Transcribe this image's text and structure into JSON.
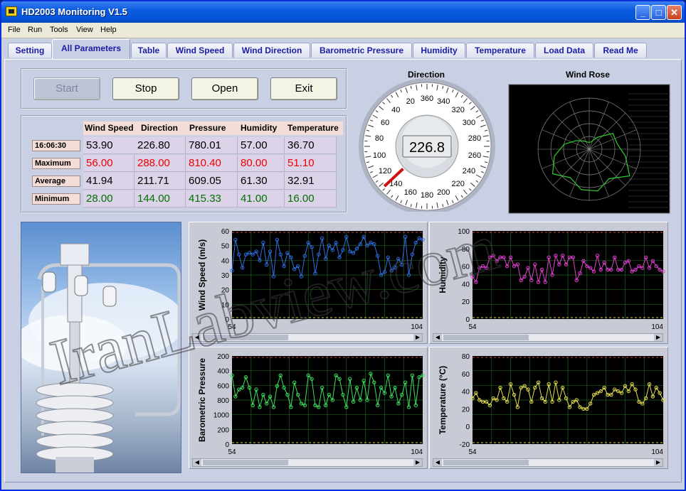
{
  "window": {
    "title": "HD2003 Monitoring V1.5"
  },
  "menu": [
    "File",
    "Run",
    "Tools",
    "View",
    "Help"
  ],
  "tabs": [
    "Setting",
    "All Parameters",
    "Table",
    "Wind Speed",
    "Wind Direction",
    "Barometric Pressure",
    "Humidity",
    "Temperature",
    "Load Data",
    "Read Me"
  ],
  "active_tab": "All Parameters",
  "buttons": {
    "start": "Start",
    "stop": "Stop",
    "open": "Open",
    "exit": "Exit"
  },
  "readings": {
    "headers": [
      "Wind Speed",
      "Direction",
      "Pressure",
      "Humidity",
      "Temperature"
    ],
    "rows": [
      {
        "label": "16:06:30",
        "values": [
          "53.90",
          "226.80",
          "780.01",
          "57.00",
          "36.70"
        ]
      },
      {
        "label": "Maximum",
        "values": [
          "56.00",
          "288.00",
          "810.40",
          "80.00",
          "51.10"
        ]
      },
      {
        "label": "Average",
        "values": [
          "41.94",
          "211.71",
          "609.05",
          "61.30",
          "32.91"
        ]
      },
      {
        "label": "Minimum",
        "values": [
          "28.00",
          "144.00",
          "415.33",
          "41.00",
          "16.00"
        ]
      }
    ]
  },
  "direction": {
    "title": "Direction",
    "value": "226.8",
    "dial_labels": [
      "360",
      "340",
      "320",
      "300",
      "280",
      "260",
      "240",
      "220",
      "200",
      "180",
      "160",
      "140",
      "120",
      "100",
      "80",
      "60",
      "40",
      "20"
    ]
  },
  "wind_rose": {
    "title": "Wind Rose"
  },
  "watermark": "IranLabview.com",
  "colors": {
    "windspeed": "#2f6fe0",
    "humidity": "#e040d0",
    "pressure": "#40e060",
    "temperature": "#e6e050",
    "rose": "#30d030"
  },
  "chart_data": [
    {
      "type": "line",
      "ylabel": "Wind Speed (m/s)",
      "xlim": [
        54,
        104
      ],
      "ylim": [
        0,
        60
      ],
      "yticks": [
        "60",
        "50",
        "40",
        "30",
        "20",
        "10",
        "0"
      ],
      "xticks": [
        "54",
        "104"
      ],
      "series": [
        {
          "values": [
            33,
            54,
            44,
            35,
            44,
            45,
            44,
            46,
            40,
            52,
            37,
            46,
            29,
            54,
            44,
            36,
            45,
            42,
            34,
            36,
            29,
            43,
            52,
            49,
            31,
            44,
            55,
            41,
            50,
            47,
            52,
            42,
            47,
            56,
            46,
            45,
            48,
            51,
            56,
            50,
            52,
            51,
            43,
            30,
            32,
            42,
            33,
            35,
            41,
            37,
            56,
            30,
            44,
            52,
            55,
            54
          ]
        }
      ]
    },
    {
      "type": "line",
      "ylabel": "Humidity",
      "xlim": [
        54,
        104
      ],
      "ylim": [
        0,
        100
      ],
      "yticks": [
        "100",
        "80",
        "60",
        "40",
        "20",
        "0"
      ],
      "xticks": [
        "54",
        "104"
      ],
      "series": [
        {
          "values": [
            48,
            42,
            58,
            60,
            58,
            70,
            72,
            66,
            70,
            70,
            60,
            70,
            60,
            62,
            44,
            48,
            58,
            44,
            62,
            42,
            56,
            42,
            70,
            50,
            72,
            62,
            72,
            62,
            70,
            70,
            44,
            52,
            66,
            60,
            58,
            54,
            72,
            56,
            64,
            56,
            56,
            70,
            56,
            56,
            64,
            66,
            54,
            56,
            60,
            58,
            70,
            58,
            66,
            60,
            56,
            54
          ]
        }
      ]
    },
    {
      "type": "line",
      "ylabel": "Barometric Pressure",
      "xlim": [
        54,
        104
      ],
      "ylim": [
        0,
        200
      ],
      "yticks": [
        "200",
        "400",
        "600",
        "800",
        "1000",
        "200",
        "0"
      ],
      "xticks": [
        "54",
        "104"
      ],
      "series": [
        {
          "values": [
            780,
            540,
            620,
            640,
            760,
            640,
            440,
            620,
            420,
            560,
            460,
            540,
            420,
            660,
            780,
            640,
            560,
            420,
            700,
            560,
            460,
            440,
            780,
            740,
            440,
            420,
            640,
            440,
            560,
            500,
            780,
            740,
            560,
            420,
            740,
            480,
            640,
            500,
            720,
            500,
            800,
            700,
            440,
            640,
            580,
            780,
            540,
            640,
            460,
            560,
            700,
            420,
            780,
            440,
            760,
            780
          ]
        }
      ]
    },
    {
      "type": "line",
      "ylabel": "Temperature (°C)",
      "xlim": [
        54,
        104
      ],
      "ylim": [
        -20,
        80
      ],
      "yticks": [
        "80",
        "60",
        "40",
        "20",
        "0",
        "-20"
      ],
      "xticks": [
        "54",
        "104"
      ],
      "series": [
        {
          "values": [
            32,
            38,
            30,
            28,
            28,
            24,
            32,
            30,
            44,
            32,
            28,
            48,
            36,
            22,
            44,
            46,
            42,
            28,
            44,
            50,
            32,
            28,
            48,
            28,
            50,
            30,
            44,
            32,
            22,
            28,
            30,
            22,
            20,
            20,
            26,
            36,
            38,
            40,
            44,
            36,
            36,
            42,
            40,
            38,
            46,
            40,
            48,
            42,
            28,
            26,
            32,
            48,
            34,
            44,
            38,
            30
          ]
        }
      ]
    }
  ]
}
